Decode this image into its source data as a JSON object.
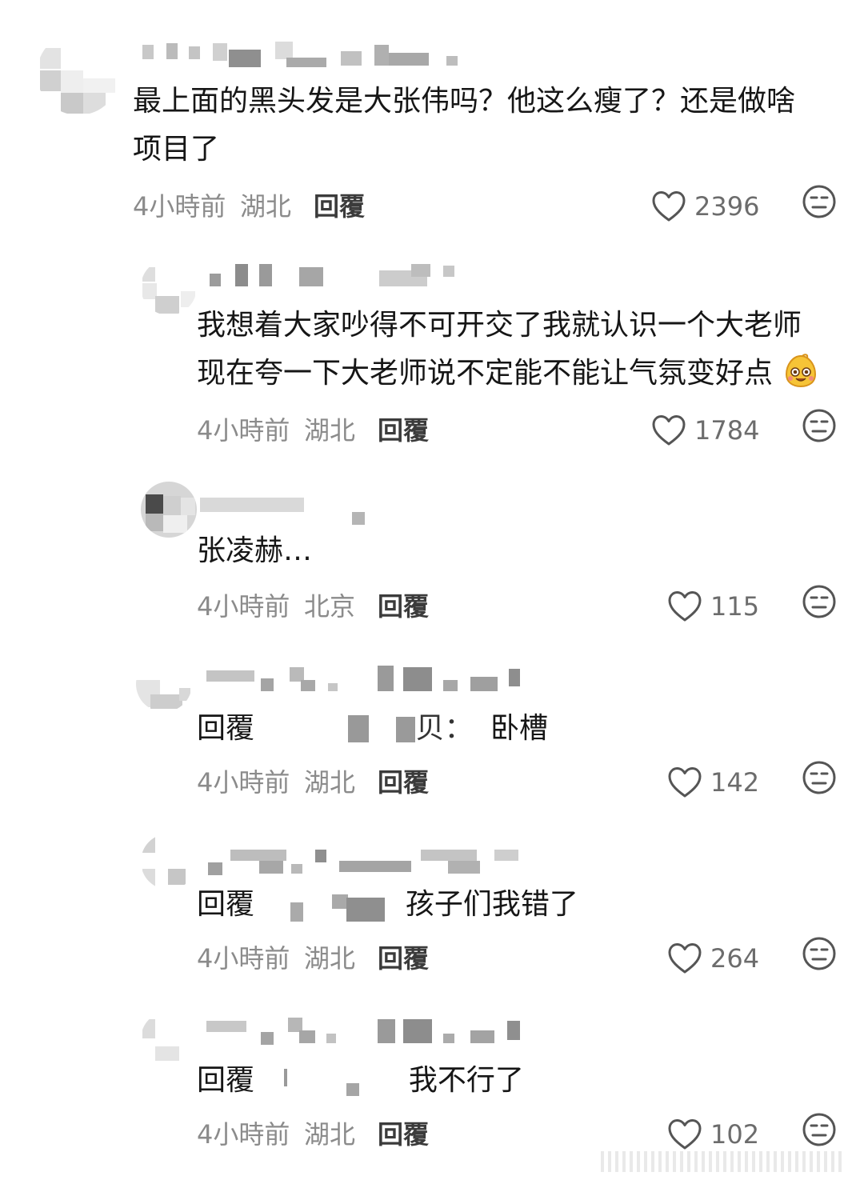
{
  "comments": [
    {
      "text_lines": [
        "最上面的黑头发是大张伟吗？他这么瘦了？还是做啥",
        "项目了"
      ],
      "time": "4小時前",
      "location": "湖北",
      "reply_label": "回覆",
      "likes": "2396"
    },
    {
      "text_lines": [
        "我想着大家吵得不可开交了我就认识一个大老师",
        "现在夸一下大老师说不定能不能让气氛变好点"
      ],
      "emoji": "smiling-face-emoji",
      "time": "4小時前",
      "location": "湖北",
      "reply_label": "回覆",
      "likes": "1784"
    },
    {
      "text_lines": [
        "张凌赫…"
      ],
      "time": "4小時前",
      "location": "北京",
      "reply_label": "回覆",
      "likes": "115"
    },
    {
      "reply_prefix": "回覆",
      "reply_to_suffix": "贝：",
      "text": "卧槽",
      "time": "4小時前",
      "location": "湖北",
      "reply_label": "回覆",
      "likes": "142"
    },
    {
      "reply_prefix": "回覆",
      "text": "孩子们我错了",
      "time": "4小時前",
      "location": "湖北",
      "reply_label": "回覆",
      "likes": "264"
    },
    {
      "reply_prefix": "回覆",
      "text": "我不行了",
      "time": "4小時前",
      "location": "湖北",
      "reply_label": "回覆",
      "likes": "102"
    }
  ],
  "icons": {
    "like": "heart-outline-icon",
    "dislike": "meh-face-icon"
  },
  "colors": {
    "text": "#161616",
    "meta": "#8b8b8b",
    "icon": "#555555"
  }
}
